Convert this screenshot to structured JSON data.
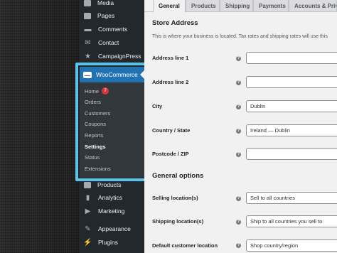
{
  "sidebar": {
    "items_top": [
      {
        "label": "Media",
        "icon": "media-icon"
      },
      {
        "label": "Pages",
        "icon": "pages-icon"
      },
      {
        "label": "Comments",
        "icon": "comments-icon"
      },
      {
        "label": "Contact",
        "icon": "contact-icon"
      },
      {
        "label": "CampaignPress",
        "icon": "star-icon"
      }
    ],
    "woocommerce": {
      "label": "WooCommerce",
      "submenu": {
        "home": "Home",
        "home_badge": "7",
        "orders": "Orders",
        "customers": "Customers",
        "coupons": "Coupons",
        "reports": "Reports",
        "settings": "Settings",
        "status": "Status",
        "extensions": "Extensions"
      }
    },
    "items_bottom": [
      {
        "label": "Products",
        "icon": "products-icon"
      },
      {
        "label": "Analytics",
        "icon": "analytics-icon"
      },
      {
        "label": "Marketing",
        "icon": "marketing-icon"
      },
      {
        "label": "Appearance",
        "icon": "appearance-icon"
      },
      {
        "label": "Plugins",
        "icon": "plugins-icon"
      }
    ]
  },
  "tabs": [
    "General",
    "Products",
    "Shipping",
    "Payments",
    "Accounts & Priva"
  ],
  "store_address": {
    "title": "Store Address",
    "description": "This is where your business is located. Tax rates and shipping rates will use this",
    "fields": [
      {
        "label": "Address line 1",
        "value": ""
      },
      {
        "label": "Address line 2",
        "value": ""
      },
      {
        "label": "City",
        "value": "Dublin"
      },
      {
        "label": "Country / State",
        "value": "Ireland — Dublin"
      },
      {
        "label": "Postcode / ZIP",
        "value": ""
      }
    ]
  },
  "general_options": {
    "title": "General options",
    "fields": [
      {
        "label": "Selling location(s)",
        "value": "Sell to all countries"
      },
      {
        "label": "Shipping location(s)",
        "value": "Ship to all countries you sell to"
      },
      {
        "label": "Default customer location",
        "value": "Shop country/region"
      }
    ]
  },
  "help_glyph": "?",
  "colors": {
    "accent": "#2271b1",
    "highlight": "#5bc2ea",
    "sidebar": "#23282d",
    "badge": "#d63638"
  }
}
